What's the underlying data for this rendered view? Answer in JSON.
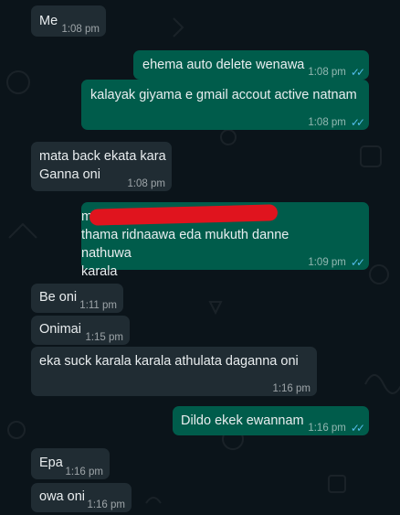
{
  "messages": [
    {
      "dir": "in",
      "text": "Me",
      "time": "1:08 pm",
      "ticks": false
    },
    {
      "dir": "out",
      "text": "ehema auto delete wenawa",
      "time": "1:08 pm",
      "ticks": true
    },
    {
      "dir": "out",
      "text": "kalayak giyama e gmail accout active natnam",
      "time": "1:08 pm",
      "ticks": true
    },
    {
      "dir": "in",
      "text": "mata back ekata kara\nGanna oni",
      "time": "1:08 pm",
      "ticks": false
    },
    {
      "dir": "out",
      "text": "mage eka\nthama ridnaawa eda mukuth danne nathuwa\nkarala",
      "time": "1:09 pm",
      "ticks": true
    },
    {
      "dir": "in",
      "text": "Be oni",
      "time": "1:11 pm",
      "ticks": false
    },
    {
      "dir": "in",
      "text": "Onimai",
      "time": "1:15 pm",
      "ticks": false
    },
    {
      "dir": "in",
      "text": "eka suck karala karala athulata daganna oni",
      "time": "1:16 pm",
      "ticks": false
    },
    {
      "dir": "out",
      "text": "Dildo ekek ewannam",
      "time": "1:16 pm",
      "ticks": true
    },
    {
      "dir": "in",
      "text": "Epa",
      "time": "1:16 pm",
      "ticks": false
    },
    {
      "dir": "in",
      "text": "owa oni",
      "time": "1:16 pm",
      "ticks": false
    }
  ],
  "colors": {
    "incoming": "#202c33",
    "outgoing": "#005c4b",
    "read_ticks": "#53bdeb",
    "redaction": "#e0141e"
  },
  "icons": {
    "read_receipt": "double-check-icon"
  }
}
